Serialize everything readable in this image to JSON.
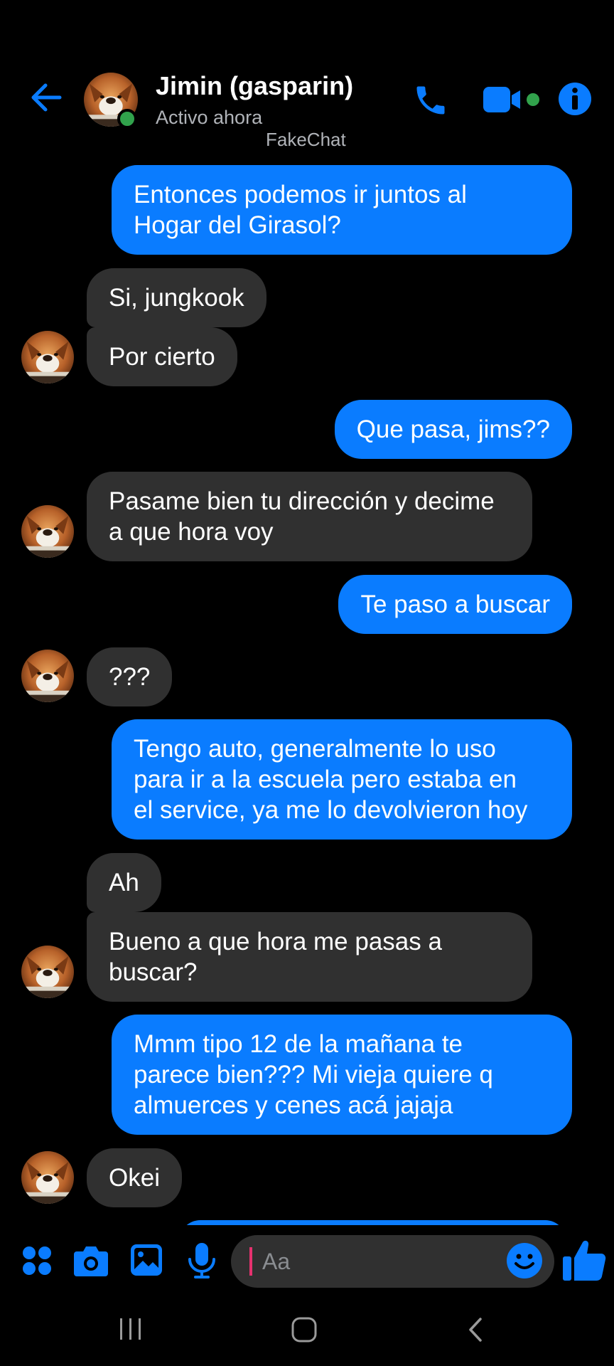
{
  "header": {
    "contact_name": "Jimin (gasparin)",
    "status": "Activo ahora",
    "watermark": "FakeChat",
    "icons": {
      "back": "arrow-left-icon",
      "phone": "phone-icon",
      "video": "video-camera-icon",
      "info": "info-icon"
    }
  },
  "messages": [
    {
      "from": "me",
      "text": "Entonces podemos ir juntos al\nHogar del Girasol?"
    },
    {
      "from": "contact",
      "text": "Si, jungkook"
    },
    {
      "from": "contact",
      "text": "Por cierto"
    },
    {
      "from": "me",
      "text": "Que pasa, jims??"
    },
    {
      "from": "contact",
      "text": "Pasame bien tu dirección y decime\na que hora voy"
    },
    {
      "from": "me",
      "text": "Te paso a buscar"
    },
    {
      "from": "contact",
      "text": "???"
    },
    {
      "from": "me",
      "text": "Tengo auto, generalmente lo uso\npara ir a la escuela pero estaba en\nel service, ya me lo devolvieron hoy"
    },
    {
      "from": "contact",
      "text": "Ah"
    },
    {
      "from": "contact",
      "text": "Bueno a que hora me pasas a\nbuscar?"
    },
    {
      "from": "me",
      "text": "Mmm tipo 12 de la mañana te\nparece bien??? Mi vieja quiere q\nalmuerces y cenes acá jajaja"
    },
    {
      "from": "contact",
      "text": "Okei"
    }
  ],
  "composer": {
    "placeholder": "Aa",
    "value": "",
    "icons": {
      "apps": "apps-grid-icon",
      "camera": "camera-icon",
      "photo": "photo-gallery-icon",
      "mic": "microphone-icon",
      "emoji": "emoji-icon",
      "like": "thumbs-up-icon"
    }
  },
  "navbar": {
    "icons": {
      "recent": "recent-apps-icon",
      "home": "home-icon",
      "back": "back-icon"
    }
  },
  "colors": {
    "accent": "#0a7cff",
    "received_bubble": "#303030",
    "background": "#000000",
    "online": "#31a24c",
    "caret": "#e5316e"
  }
}
